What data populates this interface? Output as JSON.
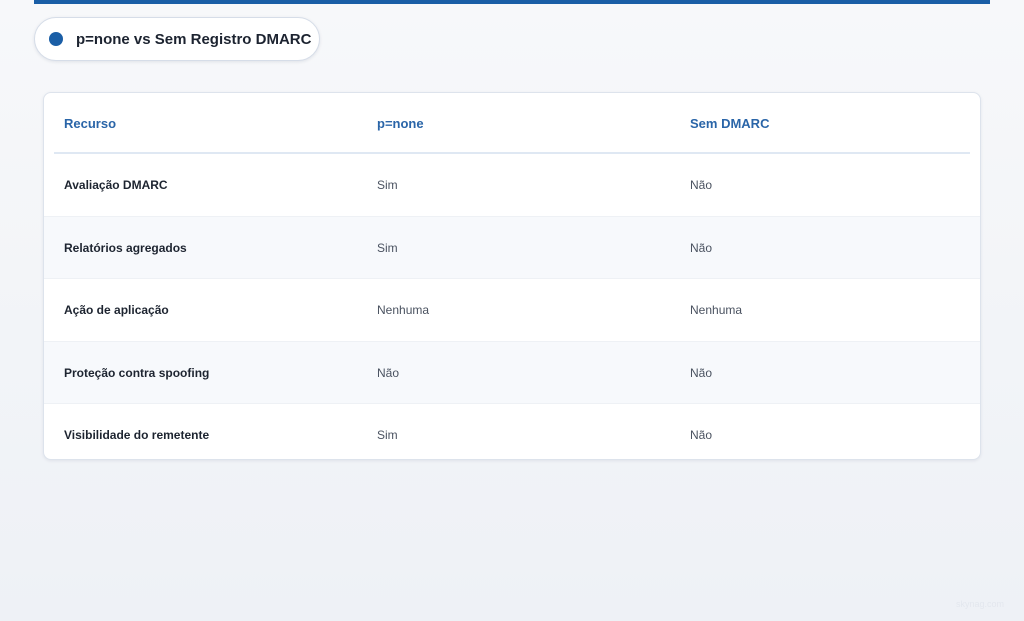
{
  "header": {
    "title": "p=none vs Sem Registro DMARC"
  },
  "table": {
    "columns": [
      "Recurso",
      "p=none",
      "Sem DMARC"
    ],
    "rows": [
      [
        "Avaliação DMARC",
        "Sim",
        "Não"
      ],
      [
        "Relatórios agregados",
        "Sim",
        "Não"
      ],
      [
        "Ação de aplicação",
        "Nenhuma",
        "Nenhuma"
      ],
      [
        "Proteção contra spoofing",
        "Não",
        "Não"
      ],
      [
        "Visibilidade do remetente",
        "Sim",
        "Não"
      ]
    ]
  },
  "watermark": "skynag.com",
  "colors": {
    "accent": "#1a5ea6",
    "header_text": "#2a65a8"
  }
}
